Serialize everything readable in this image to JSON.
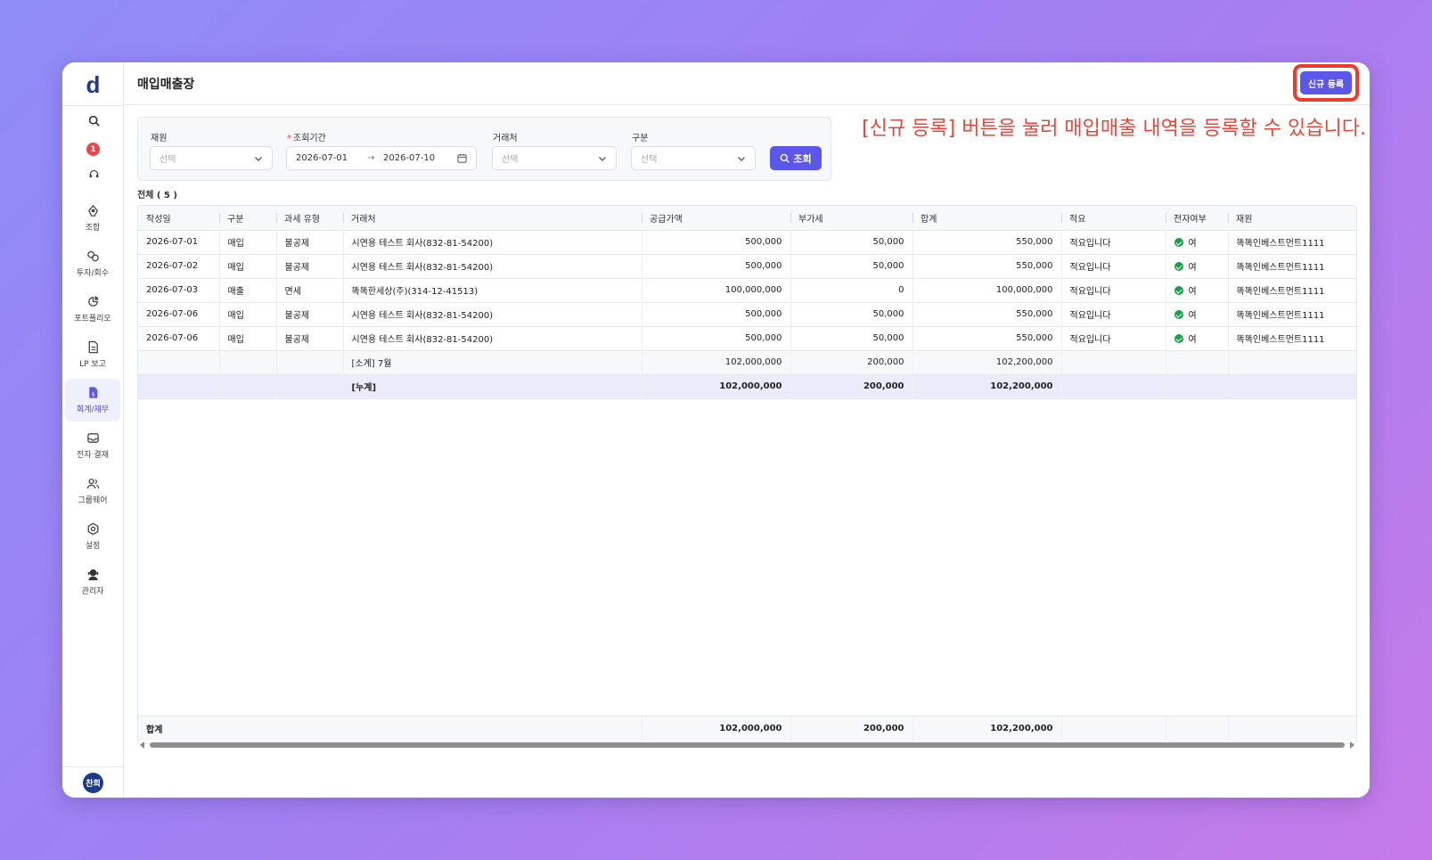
{
  "app": {
    "logo": "d",
    "page_title": "매입매출장",
    "new_button": "신규 등록",
    "annotation": "[신규 등록] 버튼을 눌러 매입매출 내역을 등록할 수 있습니다.",
    "notification_count": "1",
    "avatar_initials": "찬희"
  },
  "nav": [
    {
      "label": "조합",
      "icon": "group-icon"
    },
    {
      "label": "투자/회수",
      "icon": "investment-icon"
    },
    {
      "label": "포트폴리오",
      "icon": "pie-chart-icon"
    },
    {
      "label": "LP 보고",
      "icon": "report-icon"
    },
    {
      "label": "회계/재무",
      "icon": "accounting-icon",
      "active": true
    },
    {
      "label": "전자 결재",
      "icon": "inbox-icon"
    },
    {
      "label": "그룹웨어",
      "icon": "users-icon"
    },
    {
      "label": "설정",
      "icon": "gear-icon"
    },
    {
      "label": "관리자",
      "icon": "admin-icon"
    }
  ],
  "filters": {
    "fund_label": "재원",
    "fund_placeholder": "선택",
    "period_label": "조회기간",
    "date_from": "2026-07-01",
    "date_arrow": "→",
    "date_to": "2026-07-10",
    "partner_label": "거래처",
    "partner_placeholder": "선택",
    "type_label": "구분",
    "type_placeholder": "선택",
    "search_button": "조회"
  },
  "count_label": "전체 ( 5 )",
  "table": {
    "columns": [
      "작성일",
      "구분",
      "과세 유형",
      "거래처",
      "공급가액",
      "부가세",
      "합계",
      "적요",
      "전자여부",
      "재원"
    ],
    "rows": [
      [
        "2026-07-01",
        "매입",
        "불공제",
        "시연용 테스트 회사(832-81-54200)",
        "500,000",
        "50,000",
        "550,000",
        "적요입니다",
        "여",
        "똑똑인베스트먼트1111"
      ],
      [
        "2026-07-02",
        "매입",
        "불공제",
        "시연용 테스트 회사(832-81-54200)",
        "500,000",
        "50,000",
        "550,000",
        "적요입니다",
        "여",
        "똑똑인베스트먼트1111"
      ],
      [
        "2026-07-03",
        "매출",
        "면세",
        "똑똑한세상(주)(314-12-41513)",
        "100,000,000",
        "0",
        "100,000,000",
        "적요입니다",
        "여",
        "똑똑인베스트먼트1111"
      ],
      [
        "2026-07-06",
        "매입",
        "불공제",
        "시연용 테스트 회사(832-81-54200)",
        "500,000",
        "50,000",
        "550,000",
        "적요입니다",
        "여",
        "똑똑인베스트먼트1111"
      ],
      [
        "2026-07-06",
        "매입",
        "불공제",
        "시연용 테스트 회사(832-81-54200)",
        "500,000",
        "50,000",
        "550,000",
        "적요입니다",
        "여",
        "똑똑인베스트먼트1111"
      ]
    ],
    "subtotal": {
      "label": "[소계] 7월",
      "supply": "102,000,000",
      "vat": "200,000",
      "total": "102,200,000"
    },
    "cumulative": {
      "label": "[누계]",
      "supply": "102,000,000",
      "vat": "200,000",
      "total": "102,200,000"
    },
    "grand_total": {
      "label": "합계",
      "supply": "102,000,000",
      "vat": "200,000",
      "total": "102,200,000"
    }
  },
  "colors": {
    "accent": "#5b57e8",
    "highlight": "#ef3b2d",
    "success": "#16a34a"
  }
}
